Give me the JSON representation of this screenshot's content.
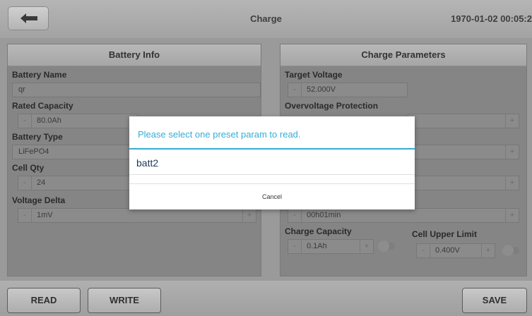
{
  "header": {
    "title": "Charge",
    "clock": "1970-01-02 00:05:2"
  },
  "battery_info": {
    "heading": "Battery Info",
    "name_label": "Battery Name",
    "name_value": "qr",
    "capacity_label": "Rated Capacity",
    "capacity_value": "80.0Ah",
    "type_label": "Battery Type",
    "type_value": "LiFePO4",
    "cellqty_label": "Cell Qty",
    "cellqty_value": "24",
    "delta_label": "Voltage Delta",
    "delta_value": "1mV"
  },
  "charge_params": {
    "heading": "Charge Parameters",
    "target_label": "Target Voltage",
    "target_value": "52.000V",
    "ovp_label": "Overvoltage Protection",
    "time_value": "00h01min",
    "capacity_label": "Charge Capacity",
    "capacity_value": "0.1Ah",
    "cell_upper_label": "Cell Upper Limit",
    "cell_upper_value": "0.400V"
  },
  "steppers": {
    "minus": "-",
    "plus": "+"
  },
  "dialog": {
    "title": "Please select one preset param to read.",
    "item": "batt2",
    "cancel": "Cancel"
  },
  "bottom": {
    "read": "READ",
    "write": "WRITE",
    "save": "SAVE"
  }
}
